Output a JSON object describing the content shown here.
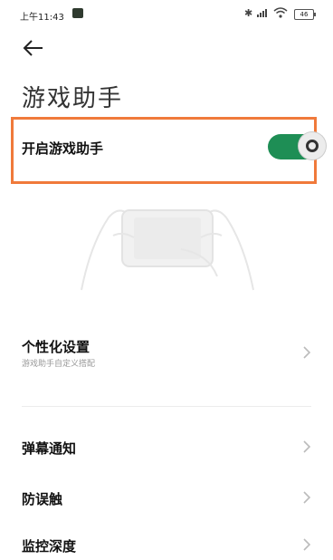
{
  "status_bar": {
    "time": "上午11:43",
    "battery": "46"
  },
  "page": {
    "title": "游戏助手"
  },
  "toggle_row": {
    "label": "开启游戏助手",
    "state": "on",
    "accent": "#1e8e55",
    "highlight_color": "#f07a3b"
  },
  "settings": [
    {
      "title": "个性化设置",
      "subtitle": "游戏助手自定义搭配"
    },
    {
      "title": "弹幕通知"
    },
    {
      "title": "防误触"
    },
    {
      "title": "监控深度"
    }
  ],
  "icons": {
    "back": "arrow-left-icon",
    "chevron": "chevron-right-icon"
  }
}
